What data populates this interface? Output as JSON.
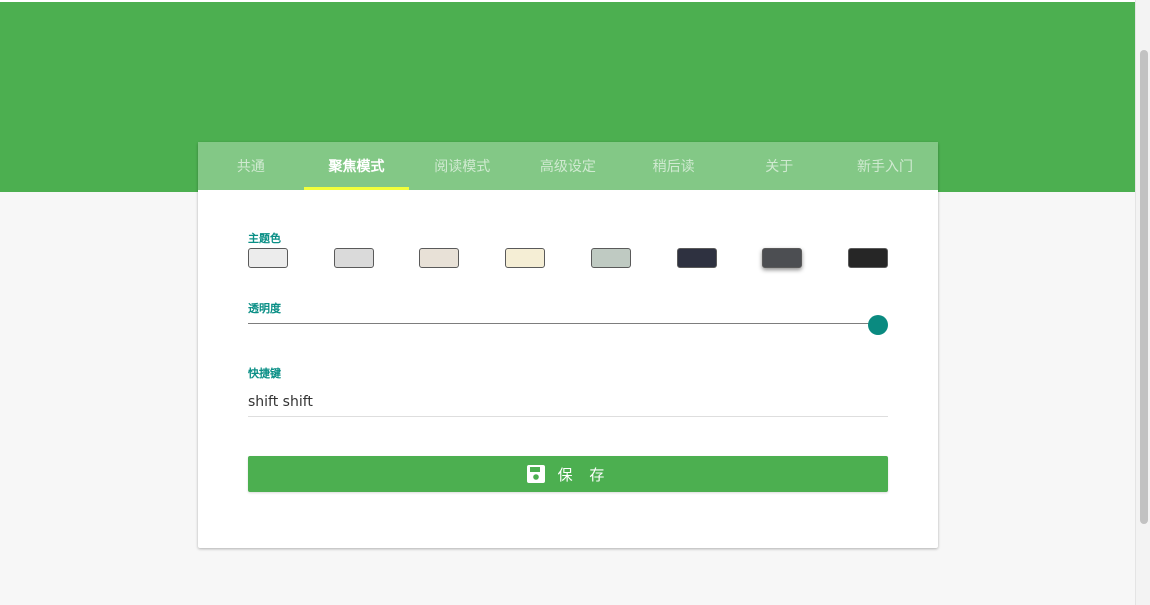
{
  "theme": {
    "header_color": "#4caf50",
    "tab_bar_color": "#83c886",
    "indicator_color": "#f2ff3a",
    "accent_color": "#0a8a80"
  },
  "tabs": [
    {
      "label": "共通",
      "active": false
    },
    {
      "label": "聚焦模式",
      "active": true
    },
    {
      "label": "阅读模式",
      "active": false
    },
    {
      "label": "高级设定",
      "active": false
    },
    {
      "label": "稍后读",
      "active": false
    },
    {
      "label": "关于",
      "active": false
    },
    {
      "label": "新手入门",
      "active": false
    }
  ],
  "focus_settings": {
    "theme_color_label": "主题色",
    "theme_colors": [
      "#ececec",
      "#dadada",
      "#e8e1d7",
      "#f5eed5",
      "#bfcac2",
      "#2e3140",
      "#4c4e52",
      "#262626"
    ],
    "selected_color_index": 6,
    "opacity_label": "透明度",
    "opacity_value": 1.0,
    "shortcut_label": "快捷键",
    "shortcut_value": "shift shift",
    "save_label": "保 存",
    "save_icon": "floppy-disk-icon"
  }
}
